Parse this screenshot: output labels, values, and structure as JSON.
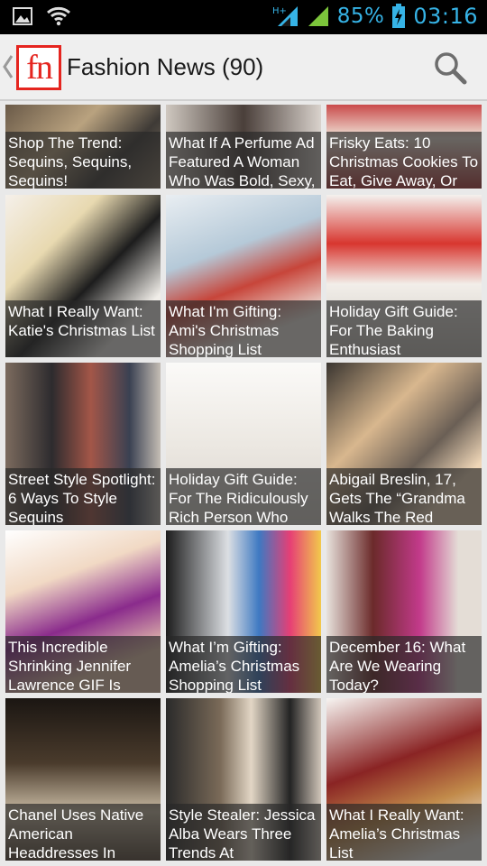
{
  "status_bar": {
    "network_type": "H+",
    "battery_percent": "85%",
    "time": "03:16"
  },
  "action_bar": {
    "logo_text": "fn",
    "title": "Fashion News (90)"
  },
  "articles": [
    {
      "title": "Shop The Trend: Sequins, Sequins, Sequins!"
    },
    {
      "title": "What If A Perfume Ad Featured A Woman Who Was Bold, Sexy,"
    },
    {
      "title": "Frisky Eats: 10 Christmas Cookies To Eat, Give Away, Or"
    },
    {
      "title": "What I Really Want: Katie's Christmas List"
    },
    {
      "title": "What I'm Gifting: Ami's Christmas Shopping List"
    },
    {
      "title": "Holiday Gift Guide: For The Baking Enthusiast"
    },
    {
      "title": "Street Style Spotlight: 6 Ways To Style Sequins"
    },
    {
      "title": "Holiday Gift Guide: For The Ridiculously Rich Person Who"
    },
    {
      "title": "Abigail Breslin, 17, Gets The “Grandma Walks The Red"
    },
    {
      "title": "This Incredible Shrinking Jennifer Lawrence GIF Is"
    },
    {
      "title": "What I’m Gifting: Amelia’s Christmas Shopping List"
    },
    {
      "title": "December 16: What Are We Wearing Today?"
    },
    {
      "title": "Chanel Uses Native American Headdresses In"
    },
    {
      "title": "Style Stealer: Jessica Alba Wears Three Trends At"
    },
    {
      "title": "What I Really Want: Amelia’s Christmas List"
    }
  ],
  "colors": {
    "status_accent": "#36b3e6",
    "brand_red": "#e5251f"
  }
}
